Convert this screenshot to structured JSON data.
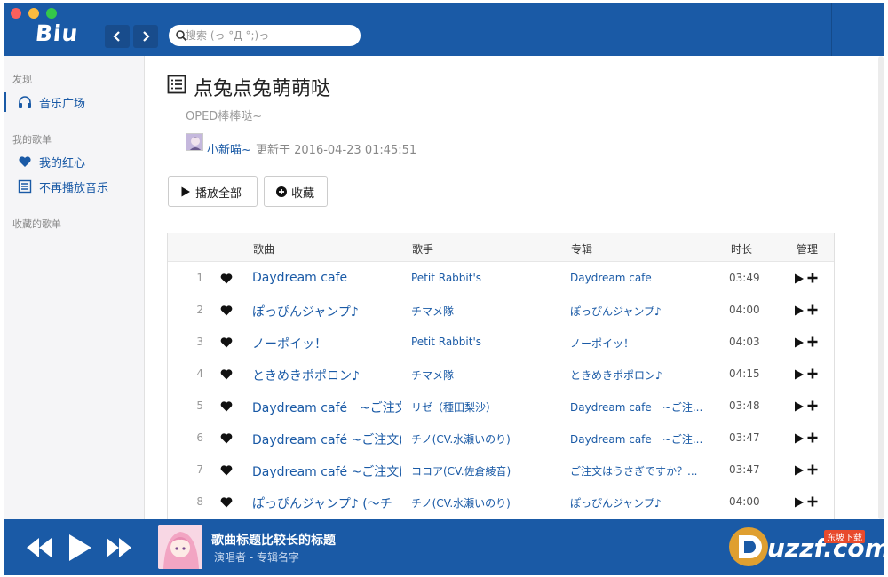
{
  "app": {
    "logo": "Biu",
    "search_placeholder": "搜索 (っ °Д °;)っ"
  },
  "sidebar": {
    "discover_heading": "发现",
    "discover_items": [
      {
        "label": "音乐广场",
        "icon": "headphones-icon"
      }
    ],
    "my_playlists_heading": "我的歌单",
    "my_playlists": [
      {
        "label": "我的红心",
        "icon": "heart-icon"
      },
      {
        "label": "不再播放音乐",
        "icon": "list-icon"
      }
    ],
    "collected_heading": "收藏的歌单"
  },
  "playlist": {
    "title": "点兔点兔萌萌哒",
    "description": "OPED棒棒哒~",
    "creator": "小新喵~",
    "updated": "更新于 2016-04-23 01:45:51",
    "play_all_label": "播放全部",
    "collect_label": "收藏"
  },
  "table": {
    "columns": [
      "歌曲",
      "歌手",
      "专辑",
      "时长",
      "管理"
    ],
    "rows": [
      {
        "index": "1",
        "song": "Daydream cafe",
        "artist": "Petit Rabbit's",
        "album": "Daydream cafe",
        "duration": "03:49"
      },
      {
        "index": "2",
        "song": "ぽっぴんジャンプ♪",
        "artist": "チマメ隊",
        "album": "ぽっぴんジャンプ♪",
        "duration": "04:00"
      },
      {
        "index": "3",
        "song": "ノーポイッ！",
        "artist": "Petit Rabbit's",
        "album": "ノーポイッ！",
        "duration": "04:03"
      },
      {
        "index": "4",
        "song": "ときめきポポロン♪",
        "artist": "チマメ隊",
        "album": "ときめきポポロン♪",
        "duration": "04:15"
      },
      {
        "index": "5",
        "song": "Daydream café　~ご注文",
        "artist": "リゼ（種田梨沙）",
        "album": "Daydream cafe　~ご注...",
        "duration": "03:48"
      },
      {
        "index": "6",
        "song": "Daydream café ~ご注文(",
        "artist": "チノ(CV.水瀬いのり)",
        "album": "Daydream cafe　~ご注...",
        "duration": "03:47"
      },
      {
        "index": "7",
        "song": "Daydream café ~ご注文は",
        "artist": "ココア(CV.佐倉綾音)",
        "album": "ご注文はうさぎですか？...",
        "duration": "03:47"
      },
      {
        "index": "8",
        "song": "ぽっぴんジャンプ♪ (～チ",
        "artist": "チノ(CV.水瀬いのり)",
        "album": "ぽっぴんジャンプ♪",
        "duration": "04:00"
      }
    ]
  },
  "player": {
    "title": "歌曲标题比较长的标题",
    "subtitle": "演唱者 - 专辑名字"
  },
  "watermark": {
    "brand": "uzzf.com",
    "tag": "东坡下载"
  },
  "colors": {
    "primary": "#1a5aa6",
    "sidebar_bg": "#f5f5f7"
  }
}
